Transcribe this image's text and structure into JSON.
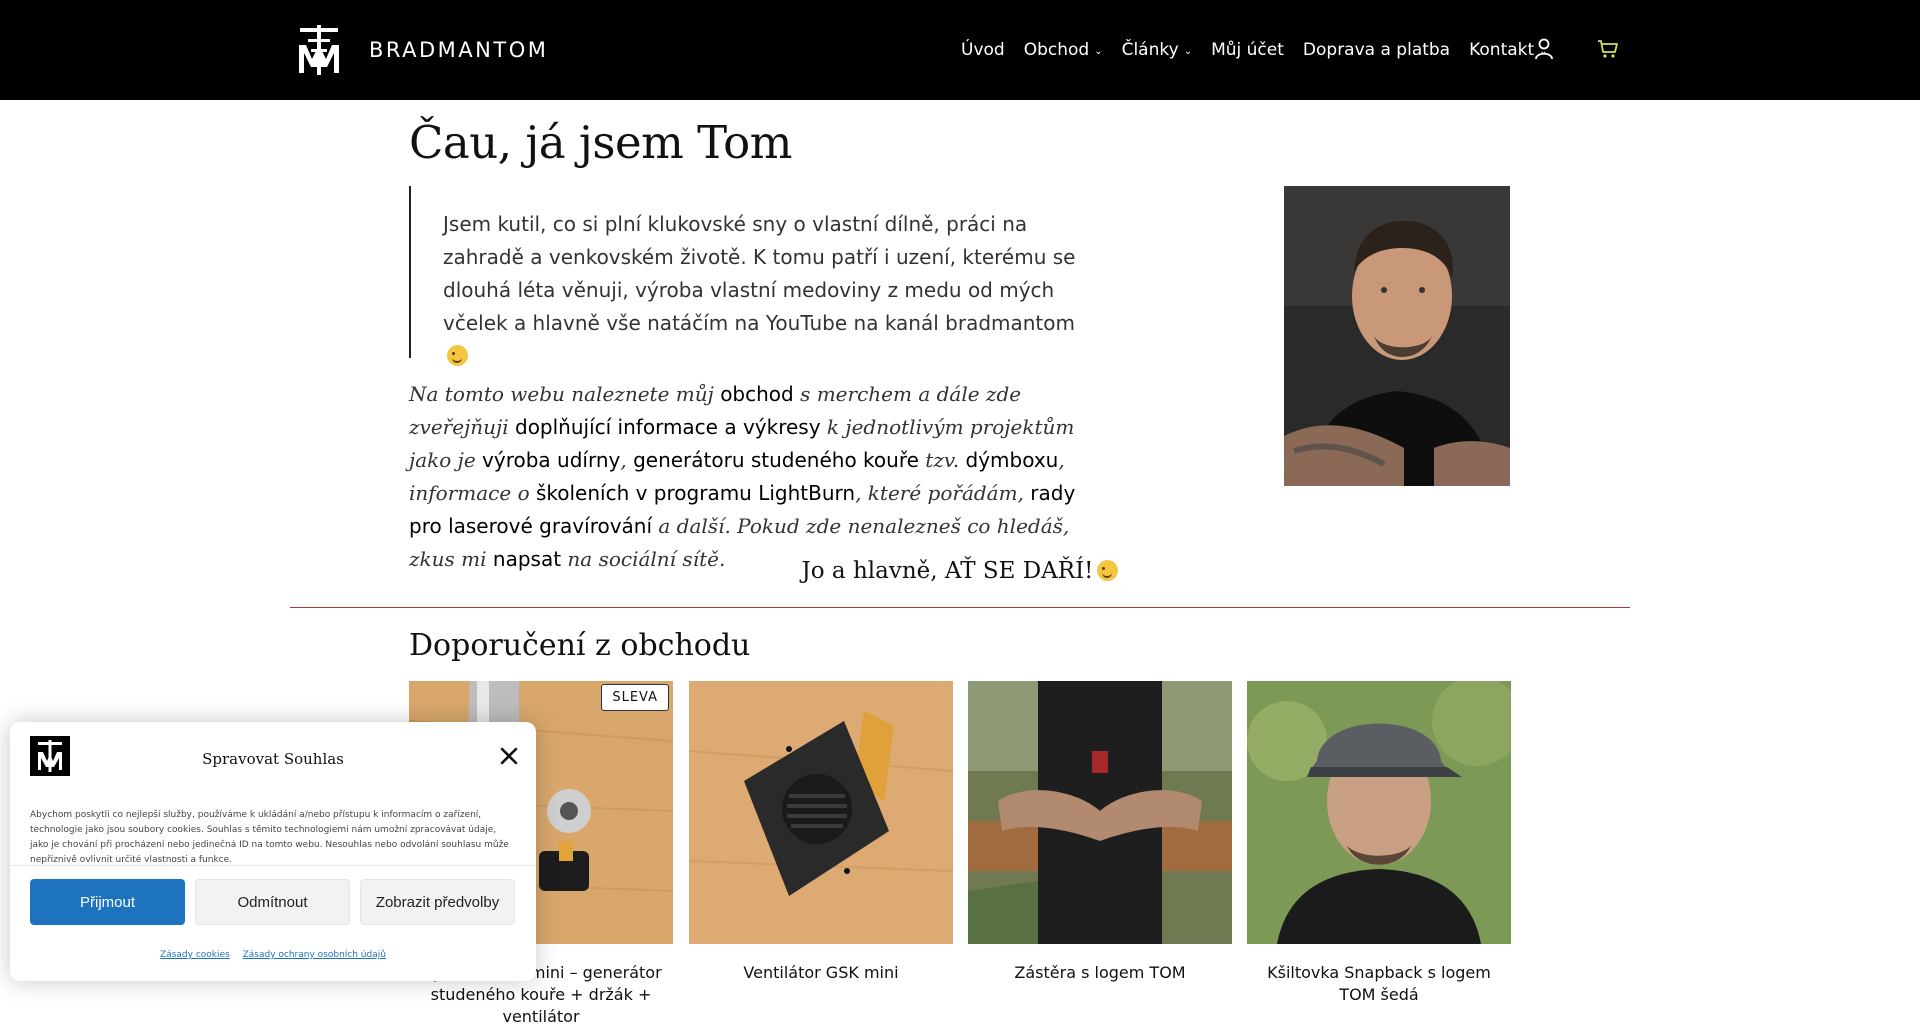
{
  "header": {
    "brand": "BRADMANTOM",
    "nav": [
      {
        "label": "Úvod",
        "dropdown": false
      },
      {
        "label": "Obchod",
        "dropdown": true
      },
      {
        "label": "Články",
        "dropdown": true
      },
      {
        "label": "Můj účet",
        "dropdown": false
      },
      {
        "label": "Doprava a platba",
        "dropdown": false
      },
      {
        "label": "Kontakt",
        "dropdown": true
      }
    ],
    "icons": {
      "user": "user-icon",
      "cart": "cart-icon"
    },
    "cart_color": "#d4e157"
  },
  "main": {
    "title": "Čau, já jsem Tom",
    "quote": "Jsem kutil, co si plní klukovské sny o vlastní dílně, práci na zahradě a venkovském životě. K tomu patří i uzení, kterému se dlouhá léta věnuji, výroba vlastní medoviny z medu od mých včelek a hlavně vše natáčím na YouTube na kanál bradmantom",
    "intro": {
      "t1": "Na tomto webu naleznete můj ",
      "l1": "obchod",
      "t2": " s merchem a dále zde zveřejňuji ",
      "l2": "doplňující informace a výkresy",
      "t3": " k jednotlivým projektům jako je ",
      "l3": "výroba udírny",
      "t4": ", ",
      "l4": "generátoru studeného kouře",
      "t5": " tzv. ",
      "l5": "dýmboxu",
      "t6": ", informace o ",
      "l6": "školeních v programu LightBurn",
      "t7": ", které pořádám, ",
      "l7": "rady pro laserové gravírování",
      "t8": " a další. Pokud zde nenalezneš co hledáš, zkus mi ",
      "l8": "napsat",
      "t9": " na sociální sítě."
    },
    "slogan": "Jo a hlavně, AŤ SE DAŘÍ!",
    "section_title": "Doporučení z obchodu",
    "products": [
      {
        "name": "Dýmbox GSK mini – generátor studeného kouře + držák + ventilátor",
        "badge": "SLEVA"
      },
      {
        "name": "Ventilátor GSK mini",
        "badge": ""
      },
      {
        "name": "Zástěra s logem TOM",
        "badge": ""
      },
      {
        "name": "Kšiltovka Snapback s logem TOM šedá",
        "badge": ""
      }
    ]
  },
  "cookie": {
    "title": "Spravovat Souhlas",
    "text": "Abychom poskytli co nejlepší služby, používáme k ukládání a/nebo přístupu k informacím o zařízení, technologie jako jsou soubory cookies. Souhlas s těmito technologiemi nám umožní zpracovávat údaje, jako je chování při procházení nebo jedinečná ID na tomto webu. Nesouhlas nebo odvolání souhlasu může nepříznivě ovlivnit určité vlastnosti a funkce.",
    "accept": "Přijmout",
    "deny": "Odmítnout",
    "prefs": "Zobrazit předvolby",
    "link1": "Zásady cookies",
    "link2": "Zásady ochrany osobních údajů",
    "accent": "#1e73be"
  }
}
